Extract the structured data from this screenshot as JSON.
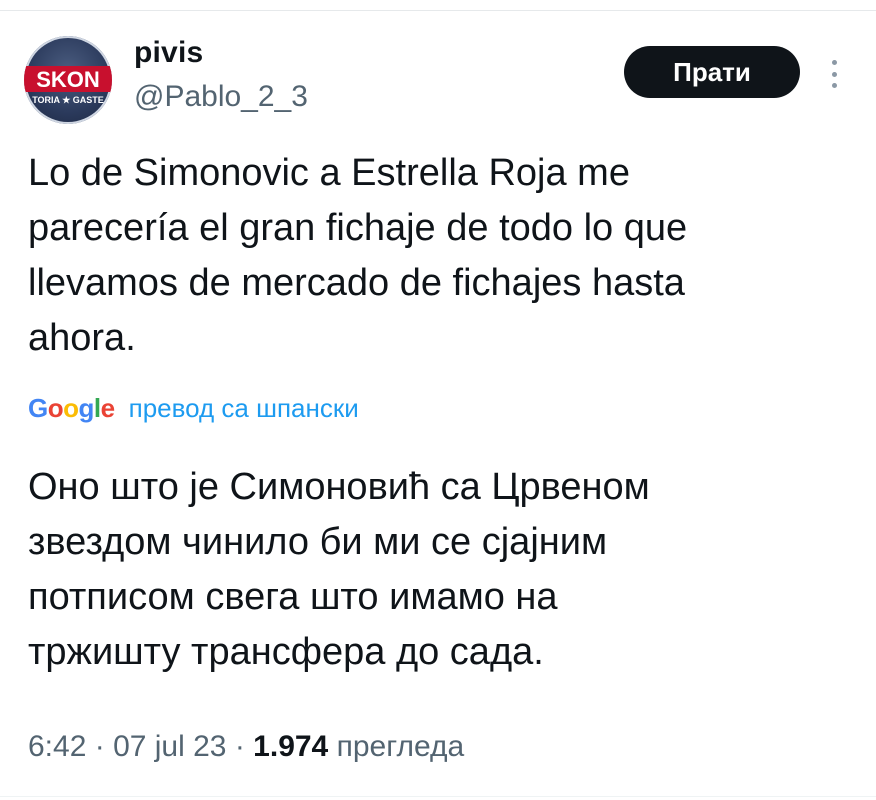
{
  "author": {
    "avatar_text": "SKON",
    "avatar_subtext": "TORIA ★ GASTE",
    "name": "pivis",
    "handle": "@Pablo_2_3"
  },
  "header": {
    "follow_label": "Прати",
    "more_icon": "more-vertical-icon"
  },
  "tweet": {
    "text": "Lo de Simonovic a Estrella Roja me\nparecería el gran fichaje de todo lo que\nllevamos de mercado de fichajes hasta\nahora.",
    "translation_provider_letters": [
      "G",
      "o",
      "o",
      "g",
      "l",
      "e"
    ],
    "translation_label": "превод са шпански",
    "translated_text": "Оно што је Симоновић са Црвеном\nзвездом чинило би ми се сјајним\nпотписом свега што имамо на\nтржишту трансфера до сада."
  },
  "meta": {
    "time": "6:42",
    "separator1": " · ",
    "date": "07 jul 23",
    "separator2": " · ",
    "views_count": "1.974",
    "views_label": " прегледа"
  },
  "colors": {
    "text": "#0f1419",
    "secondary": "#536471",
    "link": "#1d9bf0",
    "button_bg": "#0f1419",
    "button_text": "#ffffff"
  }
}
